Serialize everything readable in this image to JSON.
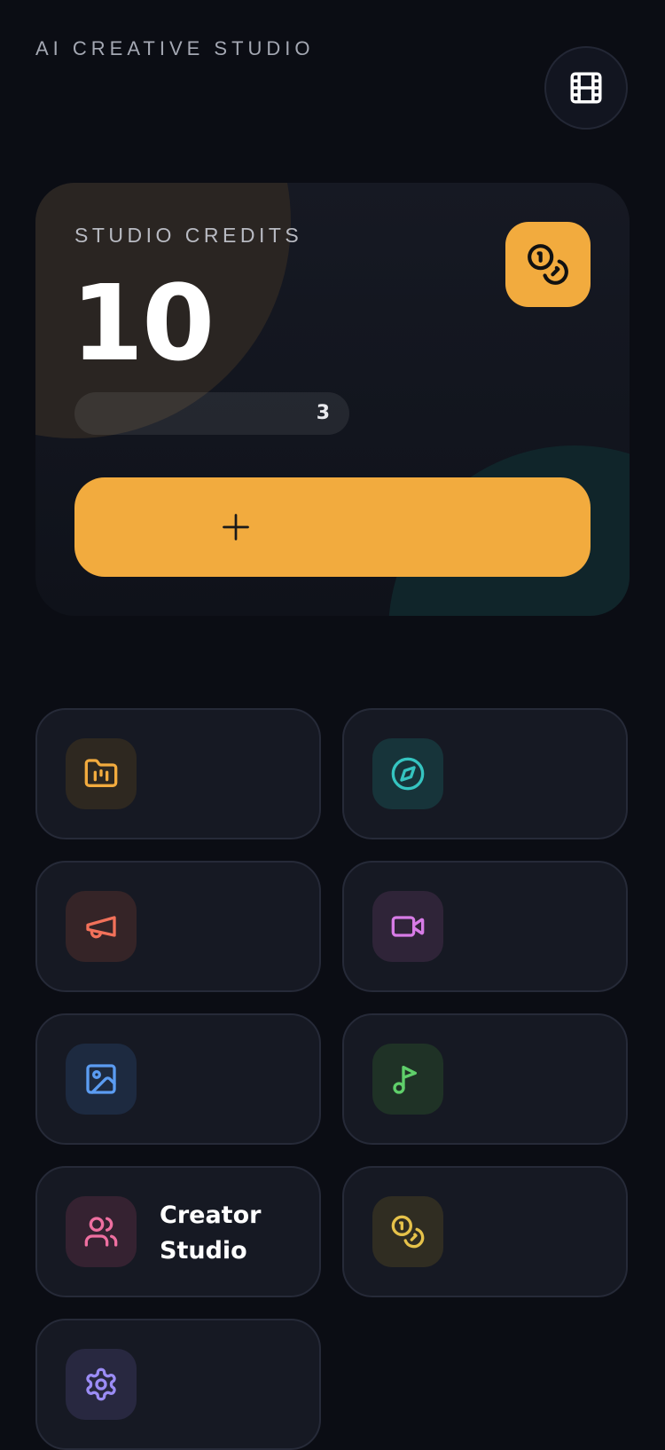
{
  "header": {
    "app_title": "AI CREATIVE STUDIO",
    "film_icon": "film-icon"
  },
  "credits_card": {
    "label": "STUDIO CREDITS",
    "value": "10",
    "usage_count": "3",
    "badge_icon": "coins-icon",
    "add_icon": "plus-icon",
    "accent_color": "#f2ab3e"
  },
  "tiles": [
    {
      "icon": "folder-chart-icon",
      "label": "",
      "color": "#f2ab3e"
    },
    {
      "icon": "compass-icon",
      "label": "",
      "color": "#35c4c0"
    },
    {
      "icon": "megaphone-icon",
      "label": "",
      "color": "#f2715a"
    },
    {
      "icon": "video-camera-icon",
      "label": "",
      "color": "#d77be6"
    },
    {
      "icon": "image-icon",
      "label": "",
      "color": "#5b9cf2"
    },
    {
      "icon": "music-note-icon",
      "label": "",
      "color": "#5fcf6a"
    },
    {
      "icon": "users-icon",
      "label": "Creator Studio",
      "color": "#ee6fa0"
    },
    {
      "icon": "coins-icon",
      "label": "",
      "color": "#e6c24a"
    },
    {
      "icon": "gear-icon",
      "label": "",
      "color": "#9b8cf5"
    }
  ]
}
